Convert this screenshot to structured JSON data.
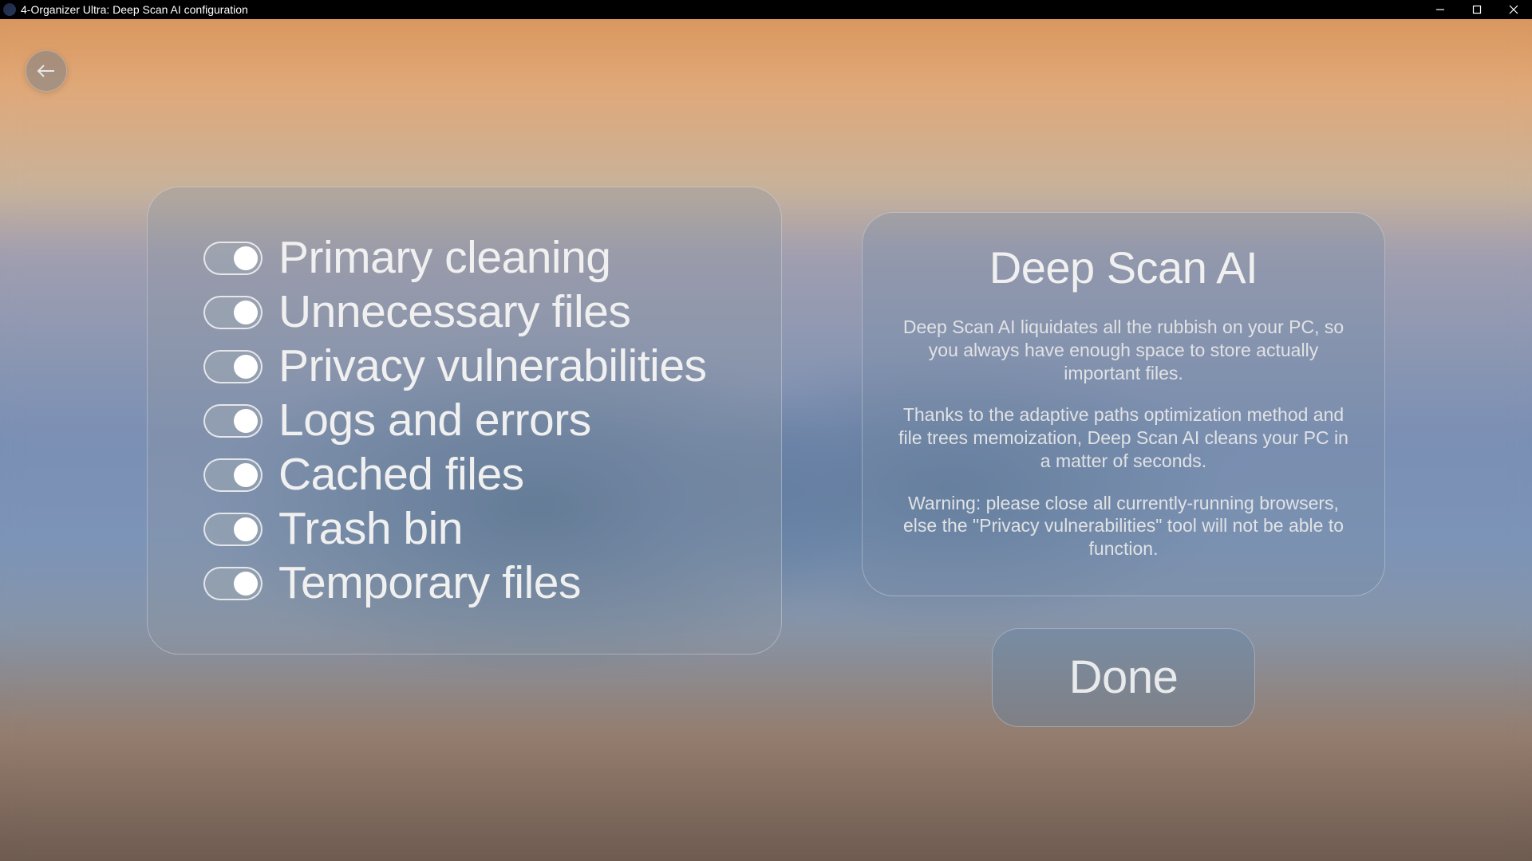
{
  "window": {
    "title": "4-Organizer Ultra: Deep Scan AI configuration"
  },
  "options": [
    {
      "label": "Primary cleaning",
      "enabled": true
    },
    {
      "label": "Unnecessary files",
      "enabled": true
    },
    {
      "label": "Privacy vulnerabilities",
      "enabled": true
    },
    {
      "label": "Logs and errors",
      "enabled": true
    },
    {
      "label": "Cached files",
      "enabled": true
    },
    {
      "label": "Trash bin",
      "enabled": true
    },
    {
      "label": "Temporary files",
      "enabled": true
    }
  ],
  "info": {
    "title": "Deep Scan AI",
    "p1": "Deep Scan AI liquidates all the rubbish on your PC, so you always have enough space to store actually important files.",
    "p2": "Thanks to the adaptive paths optimization method and file trees memoization, Deep Scan AI cleans your PC in a matter of seconds.",
    "p3": "Warning: please close all currently-running browsers, else the \"Privacy vulnerabilities\" tool will not be able to function."
  },
  "buttons": {
    "done": "Done"
  }
}
